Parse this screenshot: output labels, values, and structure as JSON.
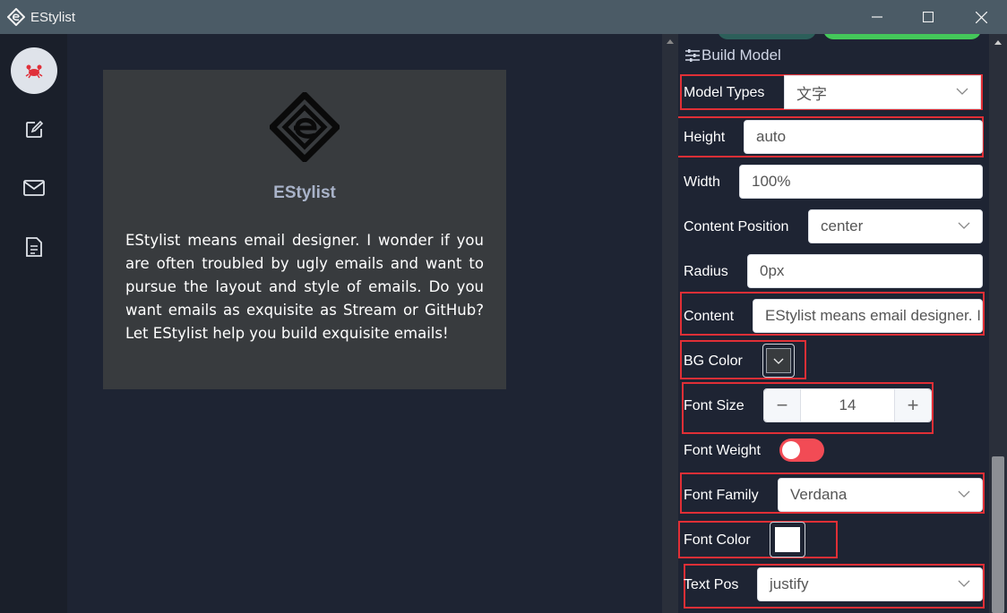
{
  "window": {
    "title": "EStylist"
  },
  "sidebar": {
    "items": [
      {
        "icon": "crab-icon"
      },
      {
        "icon": "edit-icon"
      },
      {
        "icon": "mail-icon"
      },
      {
        "icon": "document-icon"
      }
    ]
  },
  "preview": {
    "brand_name": "EStylist",
    "body_text": "EStylist means email designer. I wonder if you are often troubled by ugly emails and want to pursue the layout and style of emails. Do you want emails as exquisite as Stream or GitHub? Let EStylist help you build exquisite emails!"
  },
  "panel": {
    "heading": "Build Model",
    "model_types": {
      "label": "Model Types",
      "value": "文字"
    },
    "height": {
      "label": "Height",
      "value": "auto"
    },
    "width": {
      "label": "Width",
      "value": "100%"
    },
    "content_position": {
      "label": "Content Position",
      "value": "center"
    },
    "radius": {
      "label": "Radius",
      "value": "0px"
    },
    "content": {
      "label": "Content",
      "value": "EStylist means email designer. I wonder if you are often troubled by ugly emails"
    },
    "bg_color": {
      "label": "BG Color",
      "value": "#383b3e"
    },
    "font_size": {
      "label": "Font Size",
      "value": "14",
      "minus": "−",
      "plus": "+"
    },
    "font_weight": {
      "label": "Font Weight",
      "on": true
    },
    "font_family": {
      "label": "Font Family",
      "value": "Verdana"
    },
    "font_color": {
      "label": "Font Color",
      "value": "#ffffff"
    },
    "text_pos": {
      "label": "Text Pos",
      "value": "justify"
    }
  },
  "colors": {
    "highlight": "#e02f36",
    "toggle_on": "#f24b55",
    "brand_button": "#44c85a"
  }
}
